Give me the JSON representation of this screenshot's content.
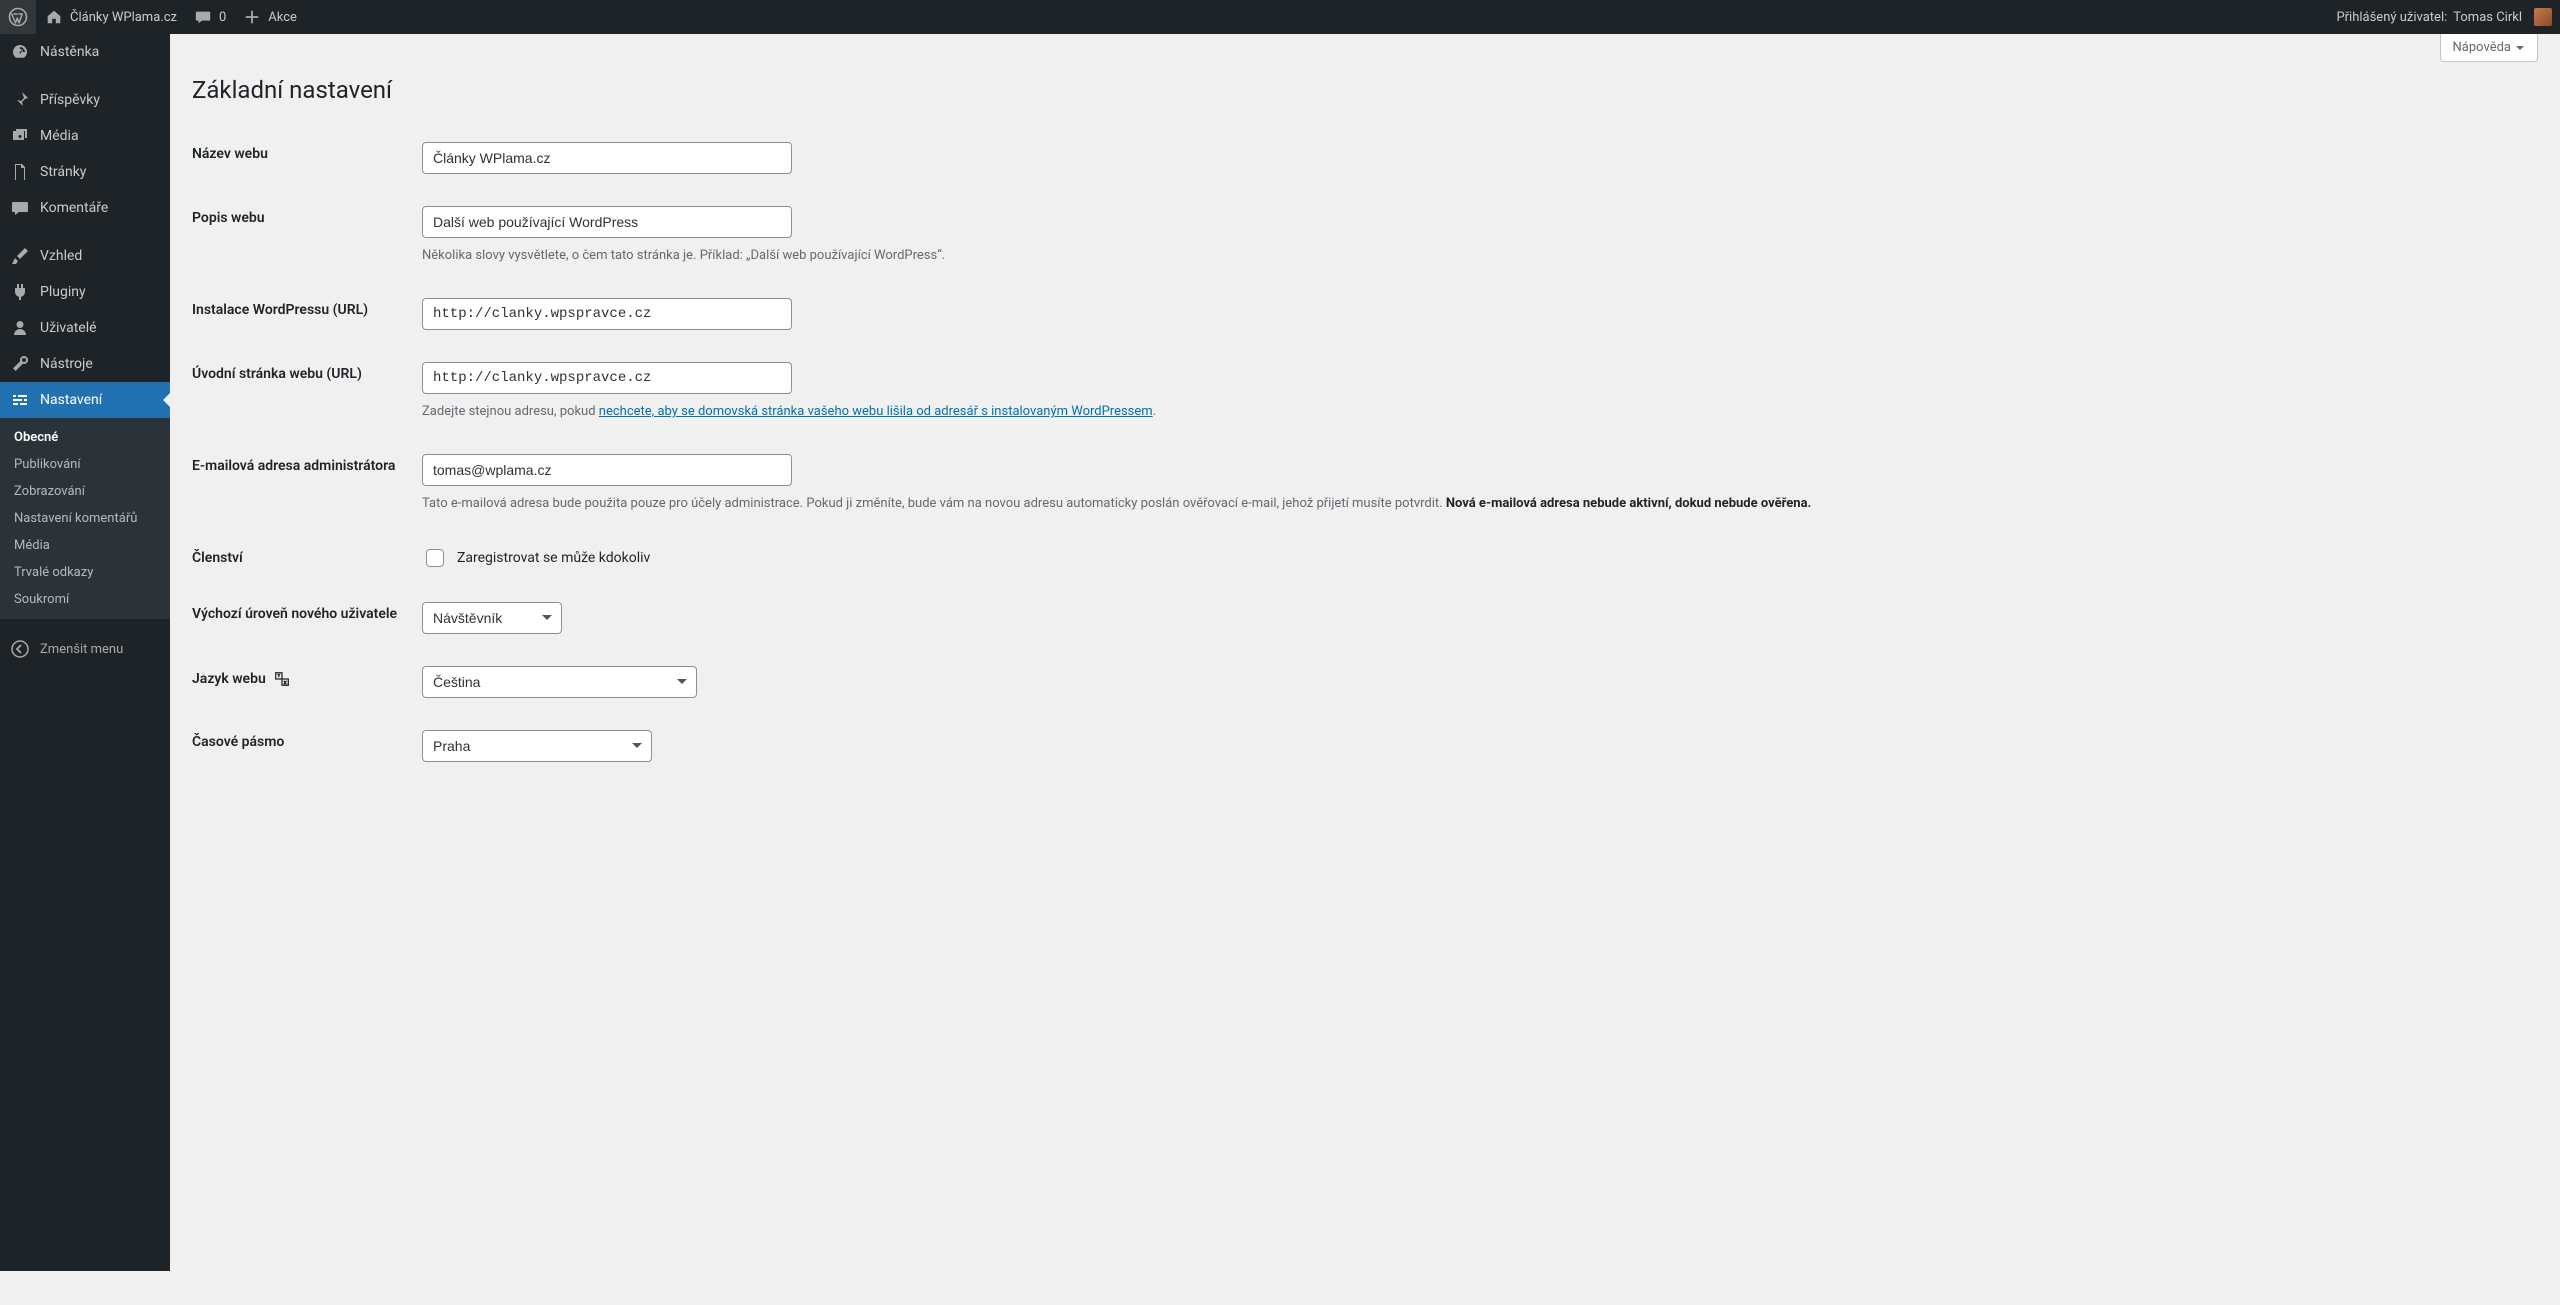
{
  "adminbar": {
    "site_name": "Články WPlama.cz",
    "comments_count": "0",
    "new_label": "Akce",
    "howdy_prefix": "Přihlášený uživatel:",
    "user_name": "Tomas Cirkl"
  },
  "help_tab": "Nápověda",
  "menu": {
    "dashboard": "Nástěnka",
    "posts": "Příspěvky",
    "media": "Média",
    "pages": "Stránky",
    "comments": "Komentáře",
    "appearance": "Vzhled",
    "plugins": "Pluginy",
    "users": "Uživatelé",
    "tools": "Nástroje",
    "settings": "Nastavení",
    "collapse": "Zmenšit menu"
  },
  "submenu": {
    "general": "Obecné",
    "writing": "Publikování",
    "reading": "Zobrazování",
    "discussion": "Nastavení komentářů",
    "media": "Média",
    "permalinks": "Trvalé odkazy",
    "privacy": "Soukromí"
  },
  "page": {
    "title": "Základní nastavení",
    "labels": {
      "blogname": "Název webu",
      "blogdescription": "Popis webu",
      "siteurl": "Instalace WordPressu (URL)",
      "home": "Úvodní stránka webu (URL)",
      "admin_email": "E-mailová adresa administrátora",
      "membership": "Členství",
      "default_role": "Výchozí úroveň nového uživatele",
      "site_language": "Jazyk webu",
      "timezone": "Časové pásmo"
    },
    "values": {
      "blogname": "Články WPlama.cz",
      "blogdescription": "Další web používající WordPress",
      "siteurl": "http://clanky.wpspravce.cz",
      "home": "http://clanky.wpspravce.cz",
      "admin_email": "tomas@wplama.cz",
      "default_role": "Návštěvník",
      "site_language": "Čeština",
      "timezone": "Praha"
    },
    "descriptions": {
      "tagline": "Několika slovy vysvětlete, o čem tato stránka je. Příklad: „Další web používající WordPress“.",
      "home_pre": "Zadejte stejnou adresu, pokud ",
      "home_link": "nechcete, aby se domovská stránka vašeho webu lišila od adresář s instalovaným WordPressem",
      "home_post": ".",
      "admin_email_1": "Tato e-mailová adresa bude použita pouze pro účely administrace. Pokud ji změníte, bude vám na novou adresu automaticky poslán ověřovací e-mail, jehož přijetí musíte potvrdit. ",
      "admin_email_strong": "Nová e-mailová adresa nebude aktivní, dokud nebude ověřena."
    },
    "membership_checkbox_label": "Zaregistrovat se může kdokoliv"
  }
}
